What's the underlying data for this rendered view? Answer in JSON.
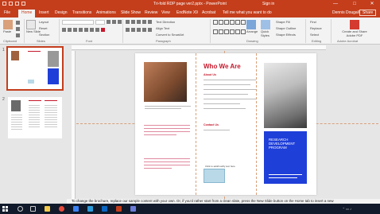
{
  "window": {
    "title": "Tri-fold RDP page ver2.pptx - PowerPoint",
    "signin": "Sign in",
    "minimize": "—",
    "maximize": "□",
    "close": "✕"
  },
  "tabs": [
    "File",
    "Home",
    "Insert",
    "Design",
    "Transitions",
    "Animations",
    "Slide Show",
    "Review",
    "View",
    "EndNote X9",
    "Acrobat"
  ],
  "active_tab": "Home",
  "tell_me": "Tell me what you want to do",
  "user": "Dennis Dougall",
  "share": "Share",
  "ribbon": {
    "clipboard": {
      "label": "Clipboard",
      "paste": "Paste"
    },
    "slides": {
      "label": "Slides",
      "new_slide": "New Slide",
      "layout": "Layout",
      "reset": "Reset",
      "section": "Section"
    },
    "font": {
      "label": "Font"
    },
    "paragraph": {
      "label": "Paragraph",
      "text_direction": "Text Direction",
      "align_text": "Align Text",
      "convert": "Convert to SmartArt"
    },
    "drawing": {
      "label": "Drawing",
      "arrange": "Arrange",
      "quick_styles": "Quick Styles",
      "shape_fill": "Shape Fill",
      "shape_outline": "Shape Outline",
      "shape_effects": "Shape Effects"
    },
    "editing": {
      "label": "Editing",
      "find": "Find",
      "replace": "Replace",
      "select": "Select"
    },
    "adobe": {
      "label": "Adobe Acrobat",
      "create": "Create and Share Adobe PDF"
    }
  },
  "thumbnails": [
    {
      "number": "1"
    },
    {
      "number": "2"
    }
  ],
  "slide": {
    "heading": "Who We Are",
    "about_label": "About Us",
    "contact_label": "Contact Us",
    "phcap": "Click to add/modify text here",
    "blue_title": "RESEARCH DEVELOPMENT PROGRAM"
  },
  "notes": "To change the brochure, replace our sample content with your own. Or, if you'd rather start from a clean slate, press the New Slide button on the Home tab to insert a new"
}
